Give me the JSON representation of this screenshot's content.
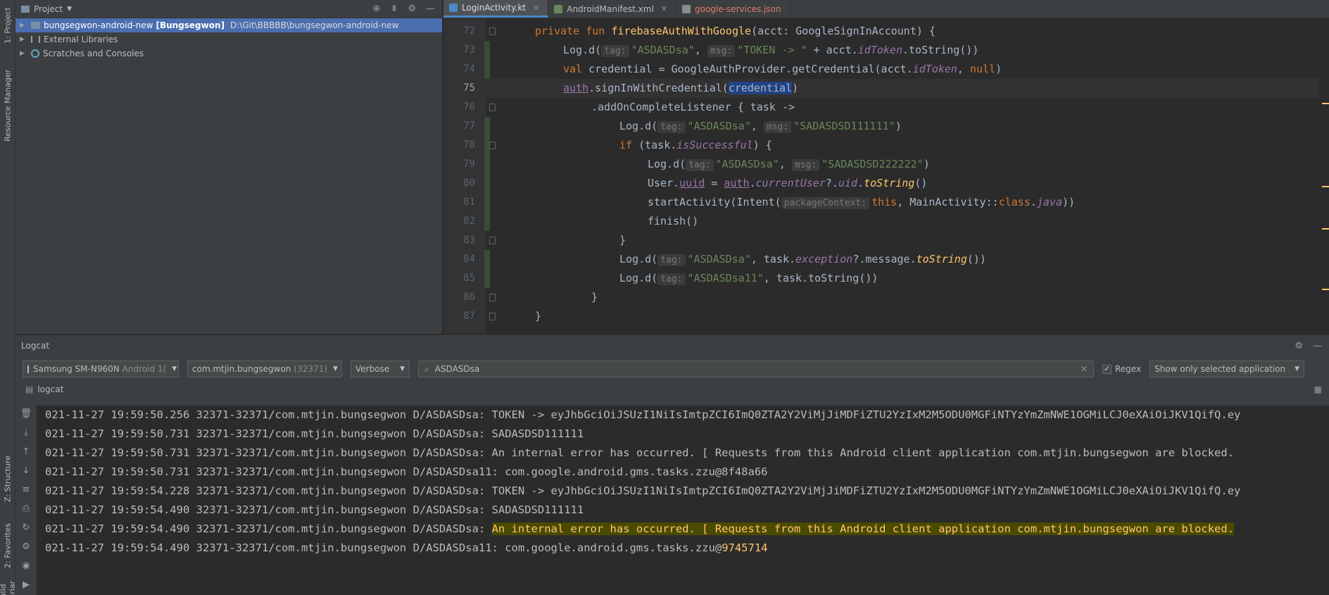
{
  "left_strip": {
    "tab_project": "1: Project",
    "tab_resource": "Resource Manager",
    "tab_structure": "Z: Structure",
    "tab_favorites": "2: Favorites",
    "tab_build": "Build Variants"
  },
  "project": {
    "title": "Project",
    "root_label": "bungsegwon-android-new",
    "root_module": "[Bungsegwon]",
    "root_path": "D:\\Git\\BBBBB\\bungsegwon-android-new",
    "external_libraries": "External Libraries",
    "scratches": "Scratches and Consoles"
  },
  "editor": {
    "tabs": [
      {
        "label": "LoginActivity.kt",
        "color": "#4a88c7"
      },
      {
        "label": "AndroidManifest.xml",
        "color": "#6a8759"
      },
      {
        "label": "google-services.json",
        "color": "#c75450"
      }
    ],
    "line_numbers": [
      "72",
      "73",
      "74",
      "75",
      "76",
      "77",
      "78",
      "79",
      "80",
      "81",
      "82",
      "83",
      "84",
      "85",
      "86",
      "87"
    ],
    "current_line": "75",
    "code": {
      "l72": {
        "kw1": "private fun ",
        "fn": "firebaseAuthWithGoogle",
        "rest": "(acct: GoogleSignInAccount) {"
      },
      "l73": {
        "a": "Log.d(",
        "h1": "tag:",
        "s1": "\"ASDASDsa\"",
        "c": ",",
        "h2": "msg:",
        "s2": "\"TOKEN -> \"",
        "b": " + acct.",
        "p": "idToken",
        "e": ".toString())"
      },
      "l74": {
        "kw": "val ",
        "a": "credential = GoogleAuthProvider.getCredential(acct.",
        "p": "idToken",
        "b": ", ",
        "kw2": "null",
        "e": ")"
      },
      "l75": {
        "u": "auth",
        "a": ".signInWithCredential(",
        "sel": "credential",
        "e": ")"
      },
      "l76": {
        "a": ".addOnCompleteListener { task ->"
      },
      "l77": {
        "a": "Log.d(",
        "h1": "tag:",
        "s1": "\"ASDASDsa\"",
        "c": ",",
        "h2": "msg:",
        "s2": "\"SADASDSD111111\"",
        "e": ")"
      },
      "l78": {
        "kw": "if ",
        "a": "(task.",
        "p": "isSuccessful",
        "e": ") {"
      },
      "l79": {
        "a": "Log.d(",
        "h1": "tag:",
        "s1": "\"ASDASDsa\"",
        "c": ",",
        "h2": "msg:",
        "s2": "\"SADASDSD222222\"",
        "e": ")"
      },
      "l80": {
        "a": "User.",
        "u": "uuid",
        "b": " = ",
        "u2": "auth",
        "c": ".",
        "p": "currentUser",
        "d": "?.",
        "p2": "uid",
        "e1": ".",
        "f": "toString",
        "e": "()"
      },
      "l81": {
        "a": "startActivity(Intent(",
        "h1": "packageContext:",
        "kw": "this",
        "b": ", MainActivity::",
        "kw2": "class",
        "c": ".",
        "p": "java",
        "e": "))"
      },
      "l82": {
        "a": "finish()"
      },
      "l83": {
        "a": "}"
      },
      "l84": {
        "a": "Log.d(",
        "h1": "tag:",
        "s1": "\"ASDASDsa\"",
        "b": ", task.",
        "p": "exception",
        "c": "?.message.",
        "f": "toString",
        "e": "())"
      },
      "l85": {
        "a": "Log.d(",
        "h1": "tag:",
        "s1": "\"ASDASDsa11\"",
        "e": ", task.toString())"
      },
      "l86": {
        "a": "}"
      },
      "l87": {
        "a": "}"
      }
    }
  },
  "logcat": {
    "title": "Logcat",
    "device": "Samsung SM-N960N",
    "device_sub": "Android 1(",
    "process": "com.mtjin.bungsegwon",
    "process_sub": "(32371)",
    "level": "Verbose",
    "search_value": "ASDASDsa",
    "regex_label": "Regex",
    "filter": "Show only selected application",
    "sub_label": "logcat",
    "lines": [
      "021-11-27 19:59:50.256 32371-32371/com.mtjin.bungsegwon D/ASDASDsa: TOKEN -> eyJhbGciOiJSUzI1NiIsImtpZCI6ImQ0ZTA2Y2ViMjJiMDFiZTU2YzIxM2M5ODU0MGFiNTYzYmZmNWE1OGMiLCJ0eXAiOiJKV1QifQ.ey",
      "021-11-27 19:59:50.731 32371-32371/com.mtjin.bungsegwon D/ASDASDsa: SADASDSD111111",
      "021-11-27 19:59:50.731 32371-32371/com.mtjin.bungsegwon D/ASDASDsa: An internal error has occurred. [ Requests from this Android client application com.mtjin.bungsegwon are blocked.",
      "021-11-27 19:59:50.731 32371-32371/com.mtjin.bungsegwon D/ASDASDsa11: com.google.android.gms.tasks.zzu@8f48a66",
      "021-11-27 19:59:54.228 32371-32371/com.mtjin.bungsegwon D/ASDASDsa: TOKEN -> eyJhbGciOiJSUzI1NiIsImtpZCI6ImQ0ZTA2Y2ViMjJiMDFiZTU2YzIxM2M5ODU0MGFiNTYzYmZmNWE1OGMiLCJ0eXAiOiJKV1QifQ.ey",
      "021-11-27 19:59:54.490 32371-32371/com.mtjin.bungsegwon D/ASDASDsa: SADASDSD111111"
    ],
    "line7_prefix": "021-11-27 19:59:54.490 32371-32371/com.mtjin.bungsegwon D/ASDASDsa: ",
    "line7_rest": "An internal error has occurred. [ Requests from this Android client application com.mtjin.bungsegwon are blocked.",
    "line8_prefix": "021-11-27 19:59:54.490 32371-32371/com.mtjin.bungsegwon D/ASDASDsa11: com.google.android.gms.tasks.zzu@",
    "line8_hash": "9745714"
  }
}
